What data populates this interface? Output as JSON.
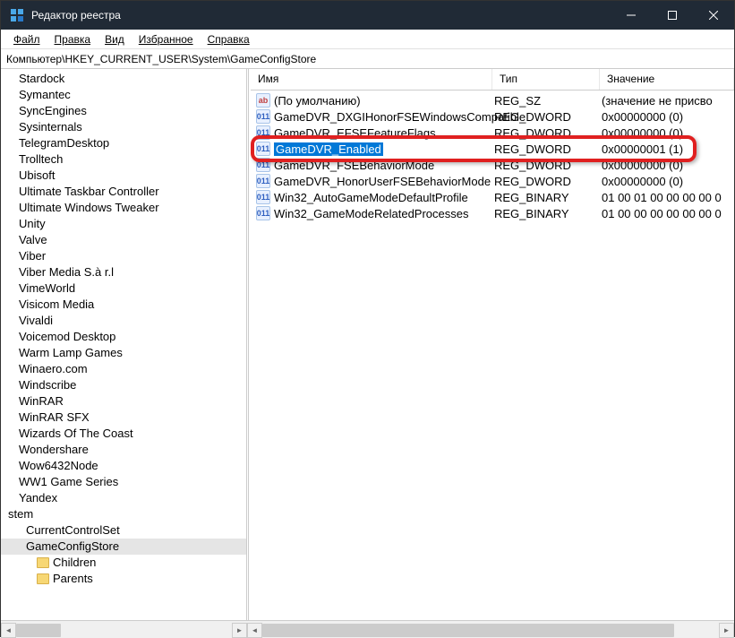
{
  "window": {
    "title": "Редактор реестра"
  },
  "menu": {
    "file": "Файл",
    "edit": "Правка",
    "view": "Вид",
    "favorites": "Избранное",
    "help": "Справка"
  },
  "address": "Компьютер\\HKEY_CURRENT_USER\\System\\GameConfigStore",
  "tree": [
    {
      "label": "Stardock",
      "indent": 0
    },
    {
      "label": "Symantec",
      "indent": 0
    },
    {
      "label": "SyncEngines",
      "indent": 0
    },
    {
      "label": "Sysinternals",
      "indent": 0
    },
    {
      "label": "TelegramDesktop",
      "indent": 0
    },
    {
      "label": "Trolltech",
      "indent": 0
    },
    {
      "label": "Ubisoft",
      "indent": 0
    },
    {
      "label": "Ultimate Taskbar Controller",
      "indent": 0
    },
    {
      "label": "Ultimate Windows Tweaker",
      "indent": 0
    },
    {
      "label": "Unity",
      "indent": 0
    },
    {
      "label": "Valve",
      "indent": 0
    },
    {
      "label": "Viber",
      "indent": 0
    },
    {
      "label": "Viber Media S.à r.l",
      "indent": 0
    },
    {
      "label": "VimeWorld",
      "indent": 0
    },
    {
      "label": "Visicom Media",
      "indent": 0
    },
    {
      "label": "Vivaldi",
      "indent": 0
    },
    {
      "label": "Voicemod Desktop",
      "indent": 0
    },
    {
      "label": "Warm Lamp Games",
      "indent": 0
    },
    {
      "label": "Winaero.com",
      "indent": 0
    },
    {
      "label": "Windscribe",
      "indent": 0
    },
    {
      "label": "WinRAR",
      "indent": 0
    },
    {
      "label": "WinRAR SFX",
      "indent": 0
    },
    {
      "label": "Wizards Of The Coast",
      "indent": 0
    },
    {
      "label": "Wondershare",
      "indent": 0
    },
    {
      "label": "Wow6432Node",
      "indent": 0
    },
    {
      "label": "WW1 Game Series",
      "indent": 0
    },
    {
      "label": "Yandex",
      "indent": 0
    },
    {
      "label": "stem",
      "indent": 0,
      "partial": true
    },
    {
      "label": "CurrentControlSet",
      "indent": 1
    },
    {
      "label": "GameConfigStore",
      "indent": 1,
      "selected": true
    },
    {
      "label": "Children",
      "indent": 2,
      "folder": true
    },
    {
      "label": "Parents",
      "indent": 2,
      "folder": true
    }
  ],
  "columns": {
    "name": "Имя",
    "type": "Тип",
    "value": "Значение"
  },
  "values": [
    {
      "icon": "sz",
      "name": "(По умолчанию)",
      "type": "REG_SZ",
      "value": "(значение не присво"
    },
    {
      "icon": "dw",
      "name": "GameDVR_DXGIHonorFSEWindowsCompatible",
      "type": "REG_DWORD",
      "value": "0x00000000 (0)"
    },
    {
      "icon": "dw",
      "name": "GameDVR_EFSEFeatureFlags",
      "type": "REG_DWORD",
      "value": "0x00000000 (0)"
    },
    {
      "icon": "dw",
      "name": "GameDVR_Enabled",
      "type": "REG_DWORD",
      "value": "0x00000001 (1)",
      "selected": true
    },
    {
      "icon": "dw",
      "name": "GameDVR_FSEBehaviorMode",
      "type": "REG_DWORD",
      "value": "0x00000000 (0)"
    },
    {
      "icon": "dw",
      "name": "GameDVR_HonorUserFSEBehaviorMode",
      "type": "REG_DWORD",
      "value": "0x00000000 (0)"
    },
    {
      "icon": "dw",
      "name": "Win32_AutoGameModeDefaultProfile",
      "type": "REG_BINARY",
      "value": "01 00 01 00 00 00 00 0"
    },
    {
      "icon": "dw",
      "name": "Win32_GameModeRelatedProcesses",
      "type": "REG_BINARY",
      "value": "01 00 00 00 00 00 00 0"
    }
  ]
}
